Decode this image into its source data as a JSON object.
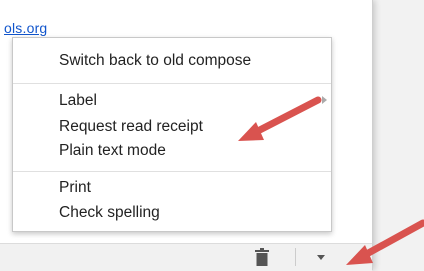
{
  "link": {
    "text": "ols.org"
  },
  "menu": {
    "groups": [
      {
        "items": [
          {
            "label": "Switch back to old compose"
          }
        ]
      },
      {
        "items": [
          {
            "label": "Label"
          },
          {
            "label": "Request read receipt"
          },
          {
            "label": "Plain text mode"
          }
        ]
      },
      {
        "items": [
          {
            "label": "Print"
          },
          {
            "label": "Check spelling"
          }
        ]
      }
    ]
  },
  "toolbar": {
    "icons": [
      "trash-icon",
      "more-options-dropdown-icon"
    ]
  },
  "colors": {
    "link": "#1155cc",
    "annotation_arrow": "#d9534f"
  }
}
